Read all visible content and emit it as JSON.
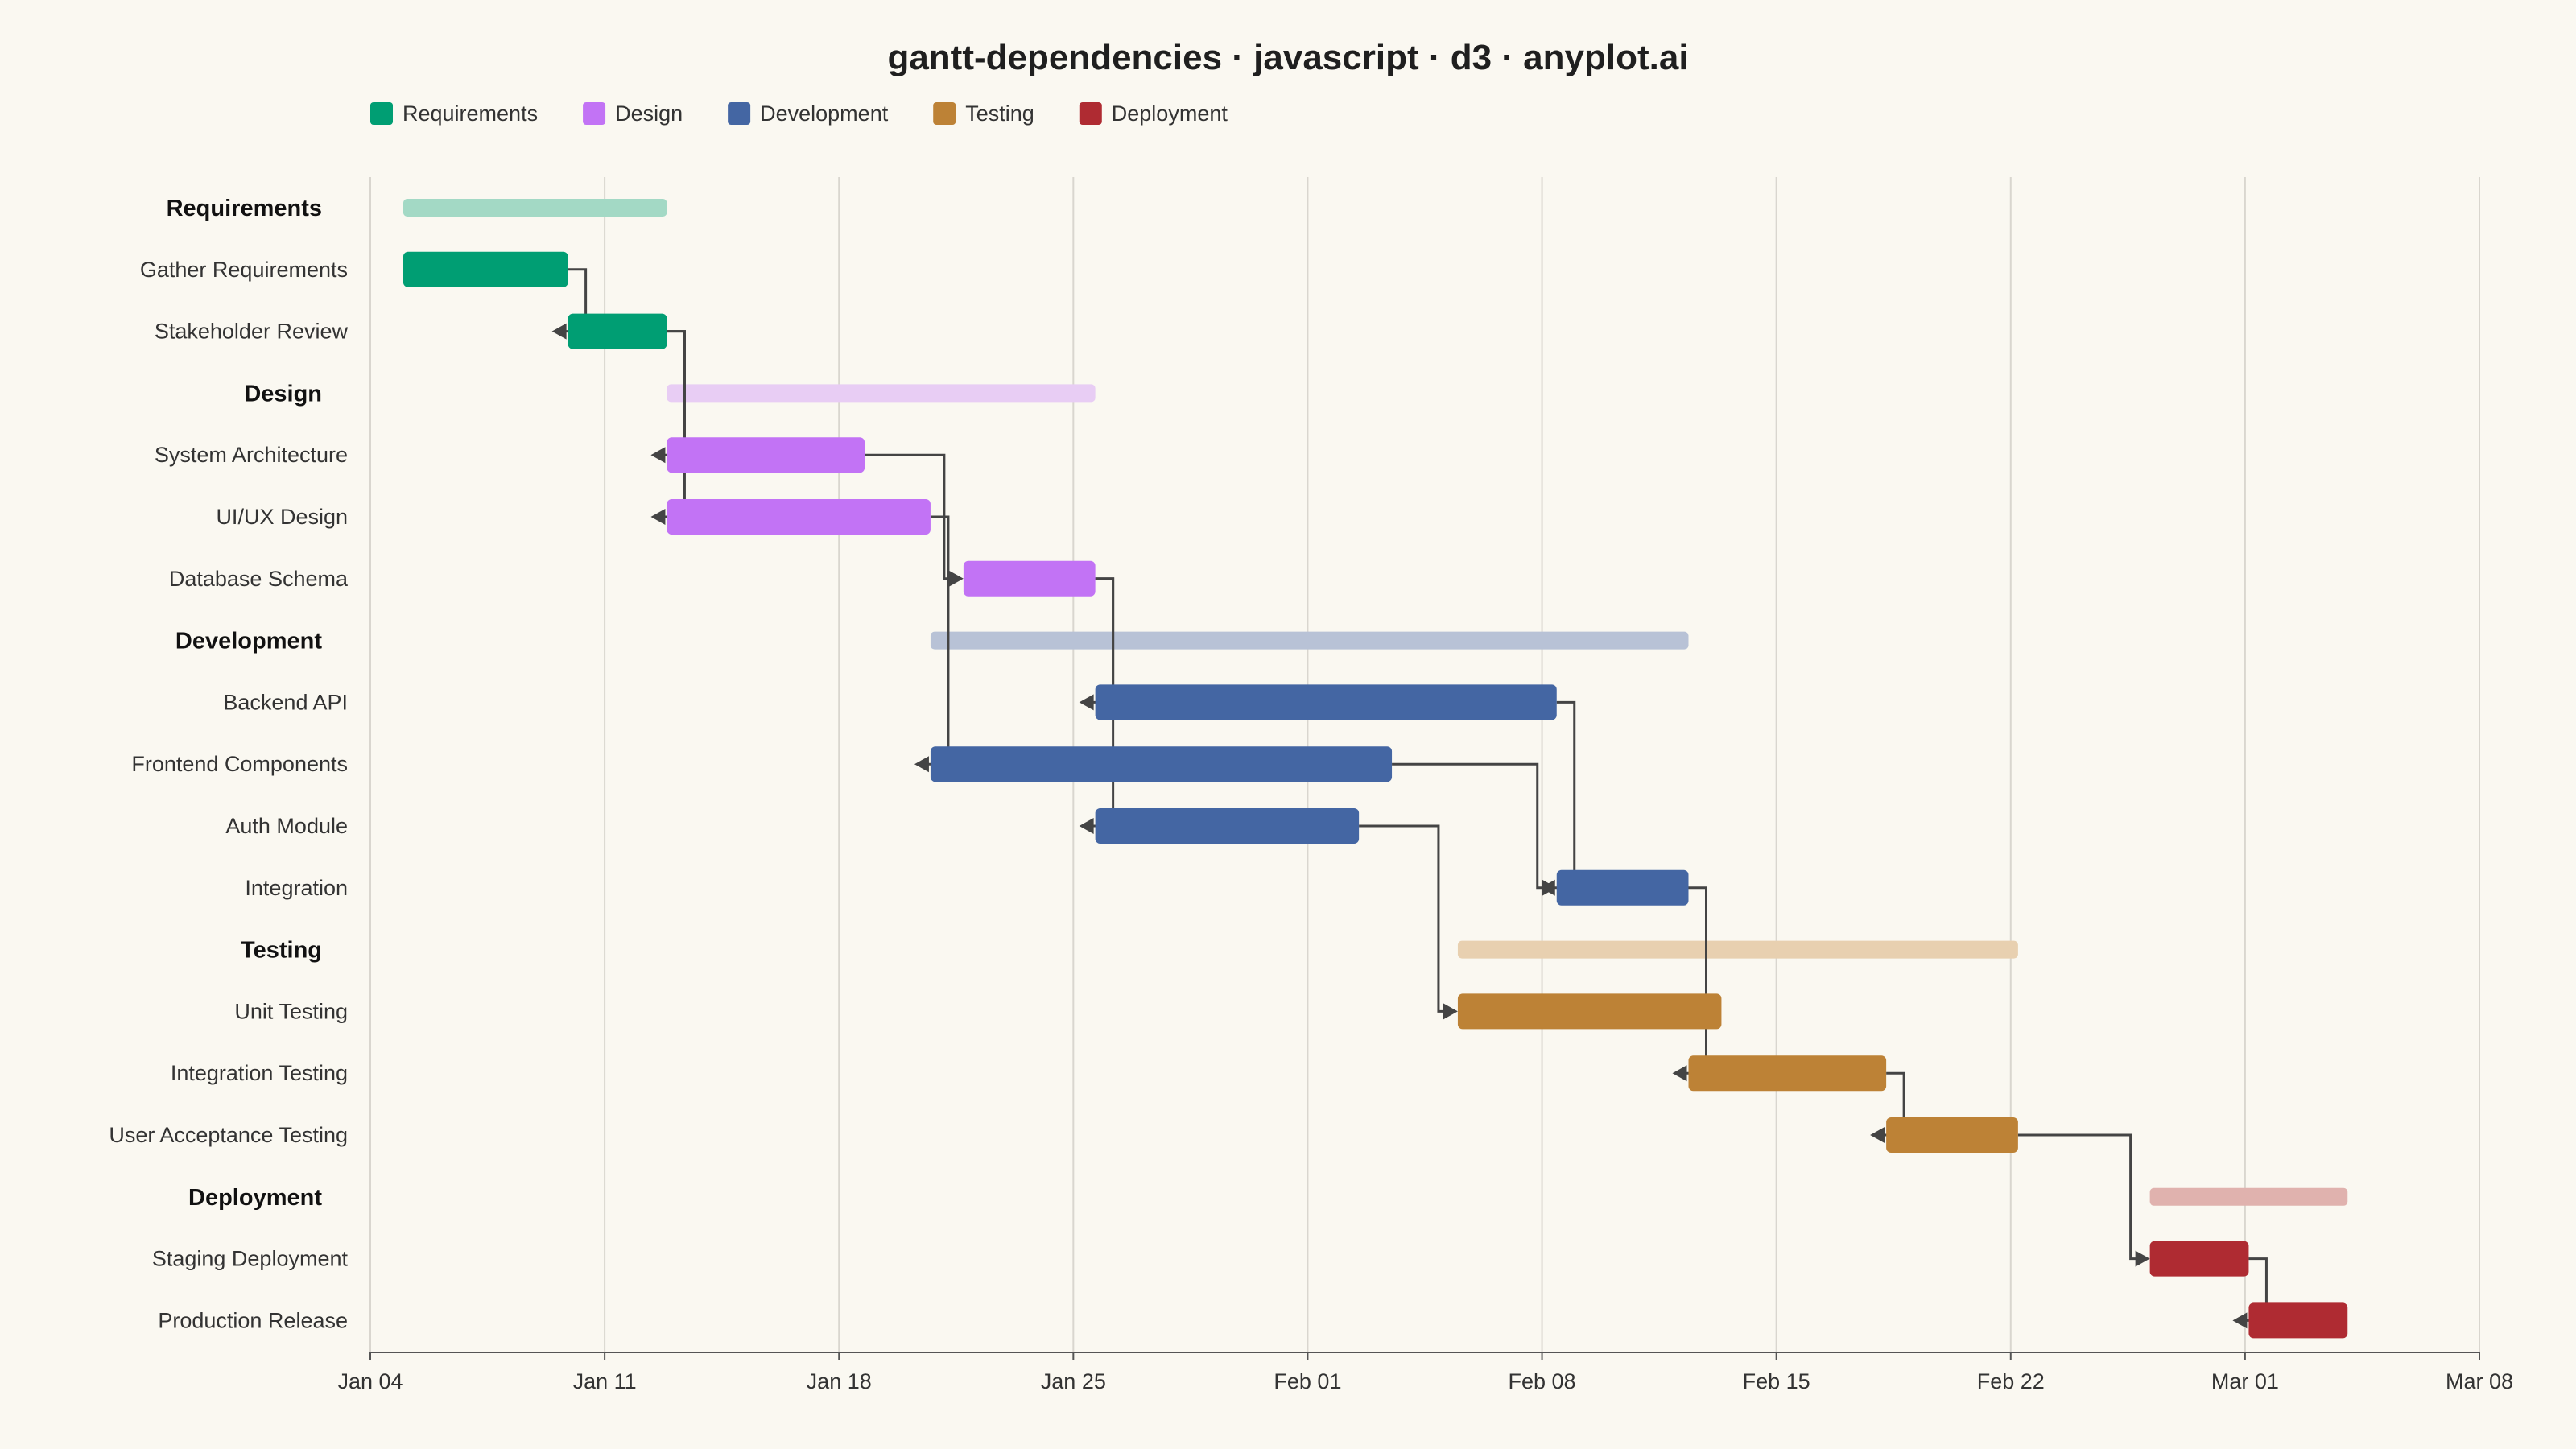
{
  "chart_data": {
    "type": "gantt",
    "title": "gantt-dependencies · javascript · d3 · anyplot.ai",
    "xlim": [
      "2024-01-04",
      "2024-03-08"
    ],
    "x_ticks": [
      "Jan 04",
      "Jan 11",
      "Jan 18",
      "Jan 25",
      "Feb 01",
      "Feb 08",
      "Feb 15",
      "Feb 22",
      "Mar 01",
      "Mar 08"
    ],
    "grid": true,
    "legend_position": "top-left",
    "groups": [
      {
        "name": "Requirements",
        "color": "#009E73",
        "summary_color": "#A3D9C5",
        "start": "2024-01-05",
        "end": "2024-01-13"
      },
      {
        "name": "Design",
        "color": "#C273F5",
        "summary_color": "#E8CDF4",
        "start": "2024-01-13",
        "end": "2024-01-26"
      },
      {
        "name": "Development",
        "color": "#4466A3",
        "summary_color": "#B8C2D6",
        "start": "2024-01-21",
        "end": "2024-02-13"
      },
      {
        "name": "Testing",
        "color": "#BD8236",
        "summary_color": "#E8D0B0",
        "start": "2024-02-06",
        "end": "2024-02-23"
      },
      {
        "name": "Deployment",
        "color": "#AF2B32",
        "summary_color": "#E0B2AE",
        "start": "2024-02-27",
        "end": "2024-03-04"
      }
    ],
    "tasks": [
      {
        "id": "gather",
        "name": "Gather Requirements",
        "group": "Requirements",
        "start": "2024-01-05",
        "end": "2024-01-10"
      },
      {
        "id": "review",
        "name": "Stakeholder Review",
        "group": "Requirements",
        "start": "2024-01-10",
        "end": "2024-01-13"
      },
      {
        "id": "arch",
        "name": "System Architecture",
        "group": "Design",
        "start": "2024-01-13",
        "end": "2024-01-19"
      },
      {
        "id": "uiux",
        "name": "UI/UX Design",
        "group": "Design",
        "start": "2024-01-13",
        "end": "2024-01-21"
      },
      {
        "id": "dbschema",
        "name": "Database Schema",
        "group": "Design",
        "start": "2024-01-22",
        "end": "2024-01-26"
      },
      {
        "id": "backend",
        "name": "Backend API",
        "group": "Development",
        "start": "2024-01-26",
        "end": "2024-02-09"
      },
      {
        "id": "frontend",
        "name": "Frontend Components",
        "group": "Development",
        "start": "2024-01-21",
        "end": "2024-02-04"
      },
      {
        "id": "auth",
        "name": "Auth Module",
        "group": "Development",
        "start": "2024-01-26",
        "end": "2024-02-03"
      },
      {
        "id": "integration",
        "name": "Integration",
        "group": "Development",
        "start": "2024-02-09",
        "end": "2024-02-13"
      },
      {
        "id": "unit",
        "name": "Unit Testing",
        "group": "Testing",
        "start": "2024-02-06",
        "end": "2024-02-14"
      },
      {
        "id": "inttest",
        "name": "Integration Testing",
        "group": "Testing",
        "start": "2024-02-13",
        "end": "2024-02-19"
      },
      {
        "id": "uat",
        "name": "User Acceptance Testing",
        "group": "Testing",
        "start": "2024-02-19",
        "end": "2024-02-23"
      },
      {
        "id": "staging",
        "name": "Staging Deployment",
        "group": "Deployment",
        "start": "2024-02-27",
        "end": "2024-03-01"
      },
      {
        "id": "prod",
        "name": "Production Release",
        "group": "Deployment",
        "start": "2024-03-01",
        "end": "2024-03-04"
      }
    ],
    "dependencies": [
      {
        "from": "gather",
        "to": "review"
      },
      {
        "from": "review",
        "to": "arch"
      },
      {
        "from": "review",
        "to": "uiux"
      },
      {
        "from": "arch",
        "to": "dbschema"
      },
      {
        "from": "uiux",
        "to": "frontend"
      },
      {
        "from": "dbschema",
        "to": "backend"
      },
      {
        "from": "dbschema",
        "to": "auth"
      },
      {
        "from": "backend",
        "to": "integration"
      },
      {
        "from": "frontend",
        "to": "integration"
      },
      {
        "from": "auth",
        "to": "unit"
      },
      {
        "from": "integration",
        "to": "inttest"
      },
      {
        "from": "inttest",
        "to": "uat"
      },
      {
        "from": "uat",
        "to": "staging"
      },
      {
        "from": "staging",
        "to": "prod"
      }
    ]
  }
}
